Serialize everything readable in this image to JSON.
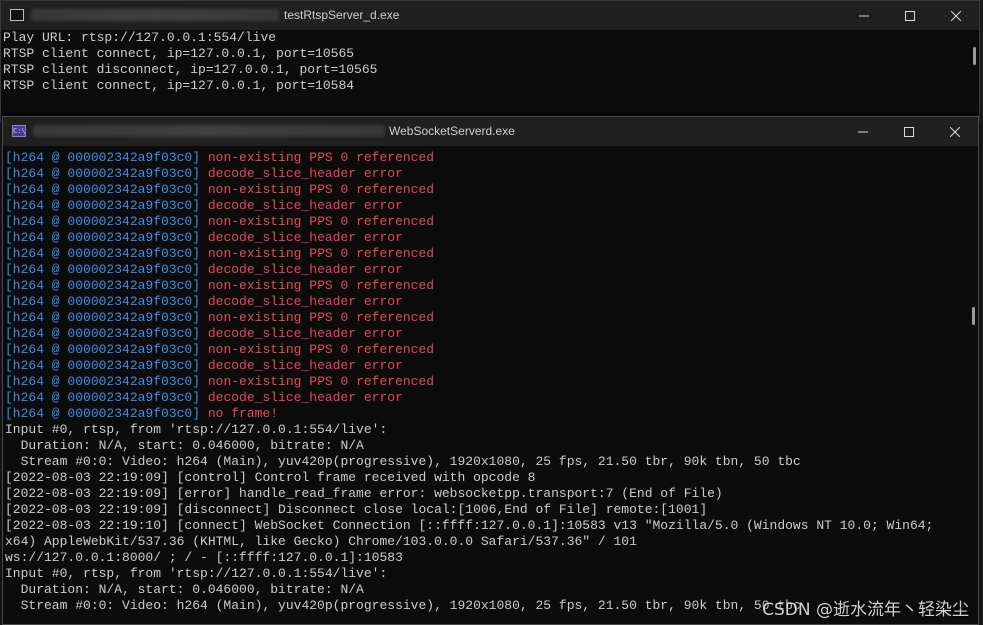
{
  "back_window": {
    "title": "testRtspServer_d.exe",
    "icon": "console-icon",
    "lines": [
      "Play URL: rtsp://127.0.0.1:554/live",
      "RTSP client connect, ip=127.0.0.1, port=10565",
      "RTSP client disconnect, ip=127.0.0.1, port=10565",
      "RTSP client connect, ip=127.0.0.1, port=10584"
    ]
  },
  "front_window": {
    "title": "WebSocketServerd.exe",
    "icon": "console-icon",
    "icon_text": "C:\\",
    "colored_lines": [
      {
        "tag": "[h264 @ 000002342a9f03c0]",
        "msg": " non-existing PPS 0 referenced"
      },
      {
        "tag": "[h264 @ 000002342a9f03c0]",
        "msg": " decode_slice_header error"
      },
      {
        "tag": "[h264 @ 000002342a9f03c0]",
        "msg": " non-existing PPS 0 referenced"
      },
      {
        "tag": "[h264 @ 000002342a9f03c0]",
        "msg": " decode_slice_header error"
      },
      {
        "tag": "[h264 @ 000002342a9f03c0]",
        "msg": " non-existing PPS 0 referenced"
      },
      {
        "tag": "[h264 @ 000002342a9f03c0]",
        "msg": " decode_slice_header error"
      },
      {
        "tag": "[h264 @ 000002342a9f03c0]",
        "msg": " non-existing PPS 0 referenced"
      },
      {
        "tag": "[h264 @ 000002342a9f03c0]",
        "msg": " decode_slice_header error"
      },
      {
        "tag": "[h264 @ 000002342a9f03c0]",
        "msg": " non-existing PPS 0 referenced"
      },
      {
        "tag": "[h264 @ 000002342a9f03c0]",
        "msg": " decode_slice_header error"
      },
      {
        "tag": "[h264 @ 000002342a9f03c0]",
        "msg": " non-existing PPS 0 referenced"
      },
      {
        "tag": "[h264 @ 000002342a9f03c0]",
        "msg": " decode_slice_header error"
      },
      {
        "tag": "[h264 @ 000002342a9f03c0]",
        "msg": " non-existing PPS 0 referenced"
      },
      {
        "tag": "[h264 @ 000002342a9f03c0]",
        "msg": " decode_slice_header error"
      },
      {
        "tag": "[h264 @ 000002342a9f03c0]",
        "msg": " non-existing PPS 0 referenced"
      },
      {
        "tag": "[h264 @ 000002342a9f03c0]",
        "msg": " decode_slice_header error"
      },
      {
        "tag": "[h264 @ 000002342a9f03c0]",
        "msg": " no frame!"
      }
    ],
    "plain_lines": [
      "Input #0, rtsp, from 'rtsp://127.0.0.1:554/live':",
      "  Duration: N/A, start: 0.046000, bitrate: N/A",
      "  Stream #0:0: Video: h264 (Main), yuv420p(progressive), 1920x1080, 25 fps, 21.50 tbr, 90k tbn, 50 tbc",
      "[2022-08-03 22:19:09] [control] Control frame received with opcode 8",
      "[2022-08-03 22:19:09] [error] handle_read_frame error: websocketpp.transport:7 (End of File)",
      "[2022-08-03 22:19:09] [disconnect] Disconnect close local:[1006,End of File] remote:[1001]",
      "[2022-08-03 22:19:10] [connect] WebSocket Connection [::ffff:127.0.0.1]:10583 v13 \"Mozilla/5.0 (Windows NT 10.0; Win64;",
      "x64) AppleWebKit/537.36 (KHTML, like Gecko) Chrome/103.0.0.0 Safari/537.36\" / 101",
      "ws://127.0.0.1:8000/ ; / - [::ffff:127.0.0.1]:10583",
      "Input #0, rtsp, from 'rtsp://127.0.0.1:554/live':",
      "  Duration: N/A, start: 0.046000, bitrate: N/A",
      "  Stream #0:0: Video: h264 (Main), yuv420p(progressive), 1920x1080, 25 fps, 21.50 tbr, 90k tbn, 50 tbc"
    ]
  },
  "window_controls": [
    "minimize-icon",
    "maximize-icon",
    "close-icon"
  ],
  "watermark": "CSDN @逝水流年丶轻染尘",
  "colors": {
    "terminal_bg": "#0c0c0c",
    "titlebar_bg": "#202020",
    "text": "#cccccc",
    "tag_blue": "#3b8eea",
    "error_red": "#e74856"
  }
}
